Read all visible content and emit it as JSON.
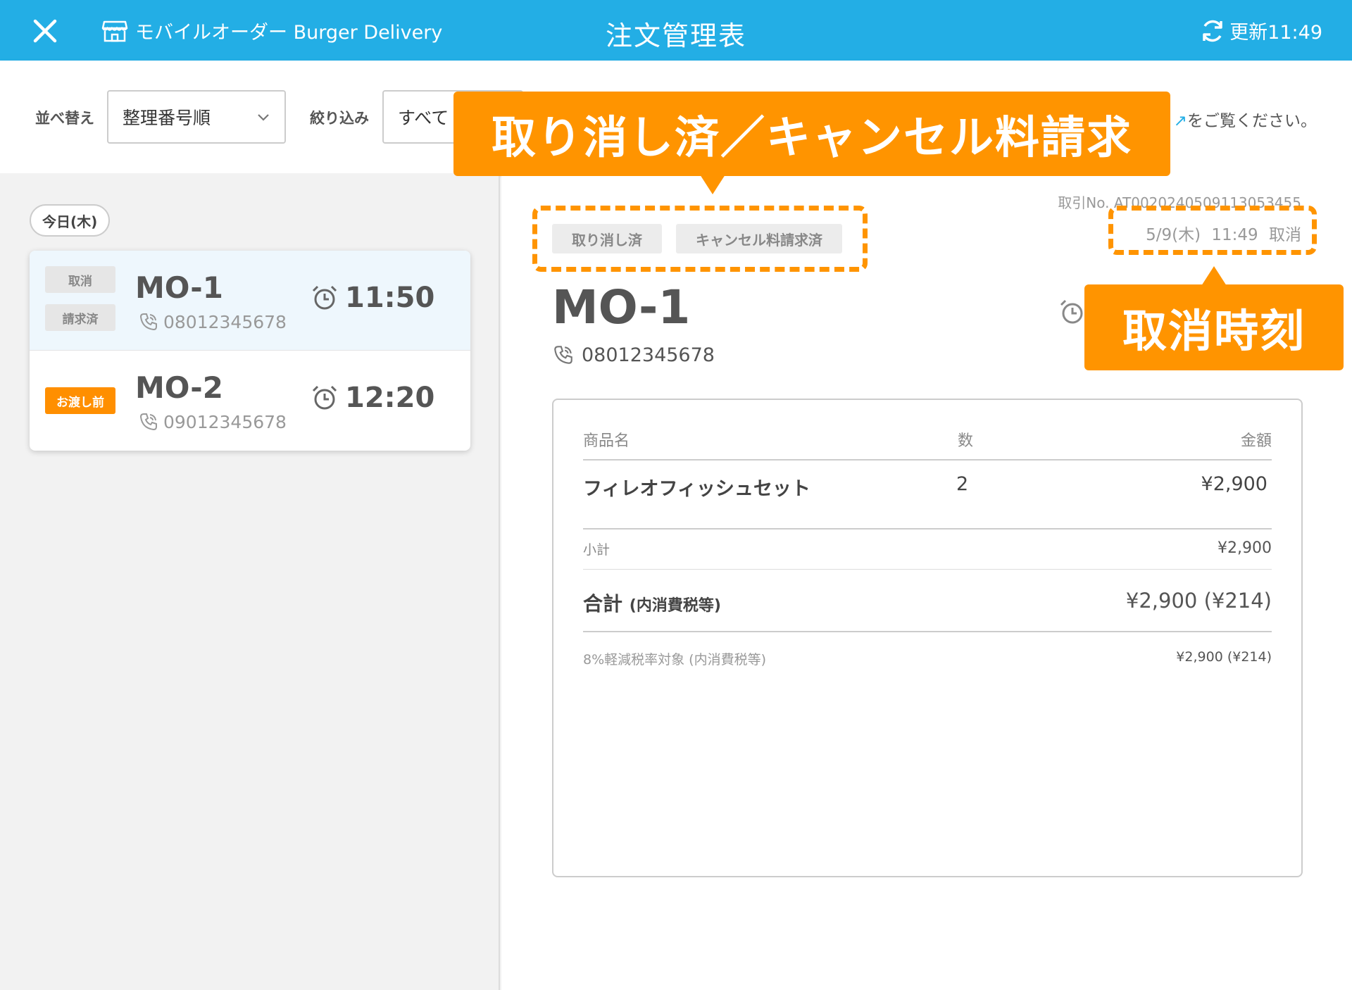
{
  "header": {
    "store_name": "モバイルオーダー Burger Delivery",
    "title": "注文管理表",
    "refresh_label": "更新11:49"
  },
  "filters": {
    "sort_label": "並べ替え",
    "sort_value": "整理番号順",
    "filter_label": "絞り込み",
    "filter_value": "すべて",
    "note": "をご覧ください。"
  },
  "list": {
    "date_chip": "今日(木)",
    "orders": [
      {
        "badges": [
          "取消",
          "請求済"
        ],
        "number": "MO-1",
        "phone": "08012345678",
        "time": "11:50"
      },
      {
        "badges": [
          "お渡し前"
        ],
        "number": "MO-2",
        "phone": "09012345678",
        "time": "12:20"
      }
    ]
  },
  "detail": {
    "transaction_no": "取引No. AT0020240509113053455",
    "status_tags": [
      "取り消し済",
      "キャンセル料請求済"
    ],
    "cancel_time": "5/9(木) 11:49 取消",
    "number": "MO-1",
    "phone": "08012345678",
    "table": {
      "headers": {
        "name": "商品名",
        "qty": "数",
        "amount": "金額"
      },
      "items": [
        {
          "name": "フィレオフィッシュセット",
          "qty": "2",
          "amount": "¥2,900"
        }
      ],
      "subtotal_label": "小計",
      "subtotal": "¥2,900",
      "total_label": "合計",
      "total_sub": "(内消費税等)",
      "total": "¥2,900 (¥214)",
      "tax_label": "8%軽減税率対象 (内消費税等)",
      "tax_value": "¥2,900 (¥214)"
    }
  },
  "annotations": {
    "callout_status": "取り消し済／キャンセル料請求",
    "callout_time": "取消時刻"
  },
  "colors": {
    "header": "#23aee5",
    "accent": "#ff9400",
    "badge_orange": "#ff8f00"
  }
}
